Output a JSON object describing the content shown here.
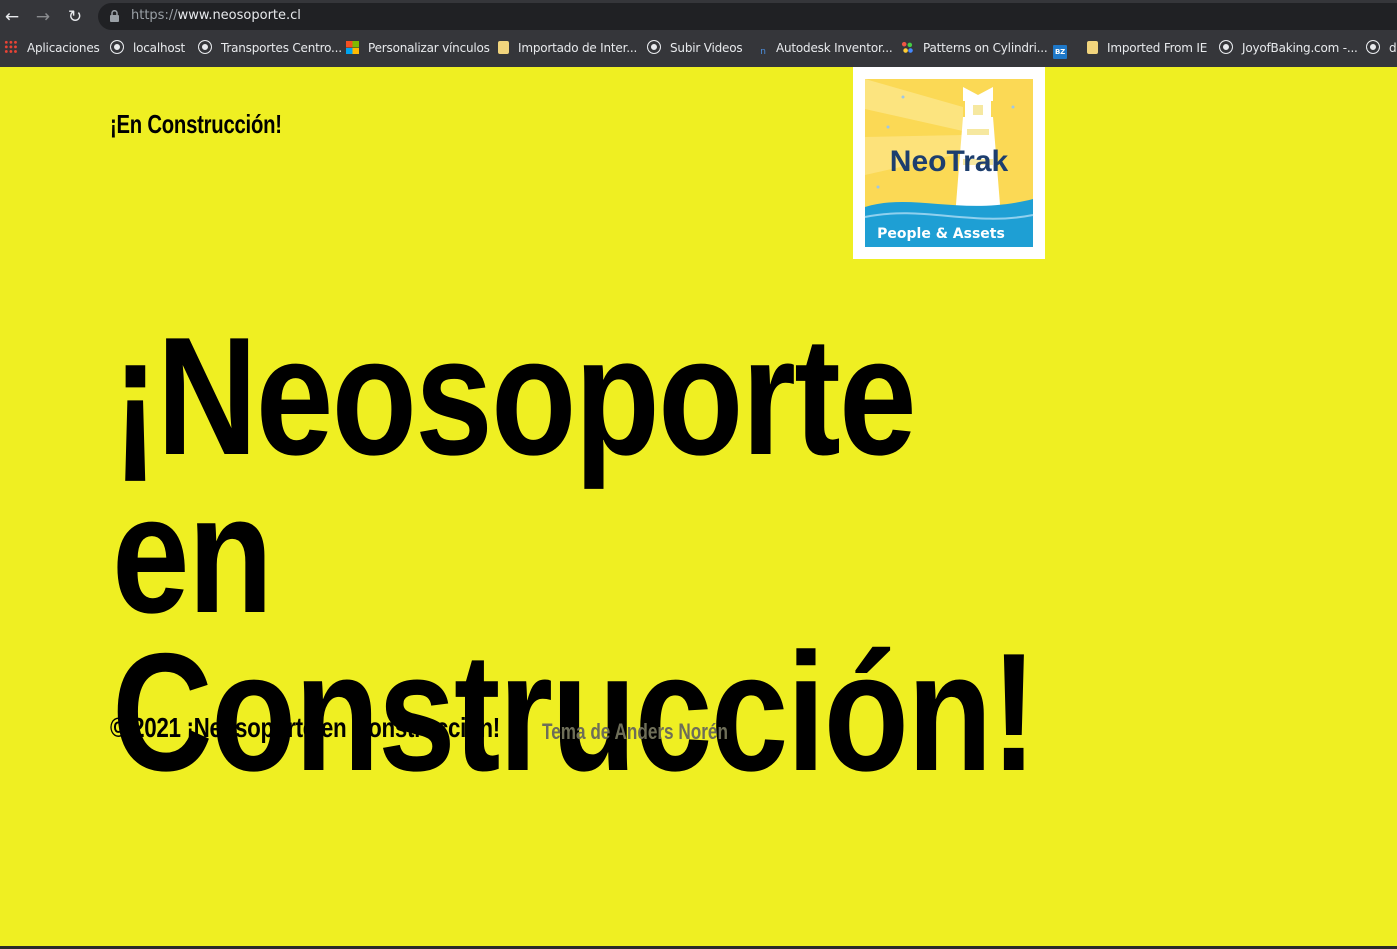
{
  "browser": {
    "url_scheme": "https://",
    "url_host": "www.neosoporte.cl",
    "bookmarks": [
      {
        "label": "Aplicaciones",
        "icon": "apps-grid-icon"
      },
      {
        "label": "localhost",
        "icon": "globe-icon"
      },
      {
        "label": "Transportes Centro...",
        "icon": "globe-icon"
      },
      {
        "label": "Personalizar vínculos",
        "icon": "microsoft-icon"
      },
      {
        "label": "Importado de Inter...",
        "icon": "folder-icon"
      },
      {
        "label": "Subir Videos",
        "icon": "globe-icon"
      },
      {
        "label": "Autodesk Inventor...",
        "icon": "autodesk-icon"
      },
      {
        "label": "Patterns on Cylindri...",
        "icon": "patterns-icon"
      },
      {
        "label": "",
        "icon": "bz-icon",
        "icon_text": "BZ"
      },
      {
        "label": "Imported From IE",
        "icon": "folder-icon"
      },
      {
        "label": "JoyofBaking.com -...",
        "icon": "globe-icon"
      },
      {
        "label": "d",
        "icon": "globe-icon"
      }
    ]
  },
  "site": {
    "title": "¡En Construcción!",
    "logo": {
      "brand": "NeoTrak",
      "tagline": "People & Assets"
    },
    "hero_line1": "¡Neosoporte en",
    "hero_line2": "Construcción!",
    "footer_copyright": "© 2021 ¡Neosoporte en Construcción!",
    "footer_credit": "Tema de Anders Norén"
  },
  "colors": {
    "page_background": "#efef22",
    "browser_chrome": "#35363a",
    "logo_blue": "#1e9fd4",
    "logo_navy": "#1d3e6e",
    "logo_yellow": "#fbd955"
  }
}
